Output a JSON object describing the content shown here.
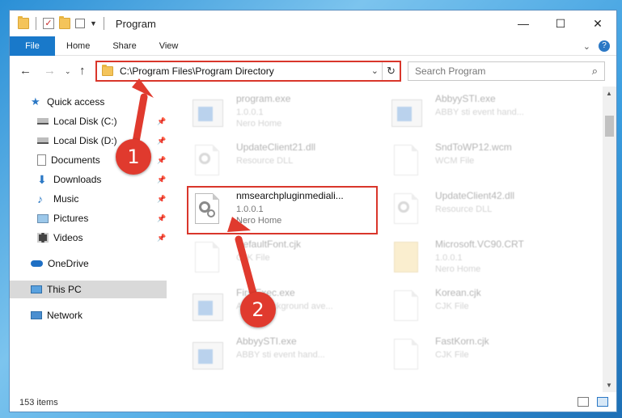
{
  "window": {
    "title": "Program"
  },
  "ribbon": {
    "tabs": [
      "File",
      "Home",
      "Share",
      "View"
    ]
  },
  "address": {
    "path": "C:\\Program Files\\Program Directory"
  },
  "search": {
    "placeholder": "Search Program"
  },
  "sidebar": {
    "items": [
      {
        "label": "Quick access",
        "icon": "star-icon"
      },
      {
        "label": "Local Disk (C:)",
        "icon": "drive-icon"
      },
      {
        "label": "Local Disk (D:)",
        "icon": "drive-icon"
      },
      {
        "label": "Documents",
        "icon": "documents-icon"
      },
      {
        "label": "Downloads",
        "icon": "download-icon"
      },
      {
        "label": "Music",
        "icon": "music-icon"
      },
      {
        "label": "Pictures",
        "icon": "pictures-icon"
      },
      {
        "label": "Videos",
        "icon": "videos-icon"
      },
      {
        "label": "OneDrive",
        "icon": "cloud-icon"
      },
      {
        "label": "This PC",
        "icon": "computer-icon"
      },
      {
        "label": "Network",
        "icon": "network-icon"
      }
    ]
  },
  "files": [
    {
      "name": "program.exe",
      "l2": "1.0.0.1",
      "l3": "Nero Home"
    },
    {
      "name": "AbbyySTI.exe",
      "l2": "ABBY sti event hand...",
      "l3": ""
    },
    {
      "name": "UpdateClient21.dll",
      "l2": "Resource DLL",
      "l3": ""
    },
    {
      "name": "SndToWP12.wcm",
      "l2": "WCM File",
      "l3": ""
    },
    {
      "name": "nmsearchpluginmediali...",
      "l2": "1.0.0.1",
      "l3": "Nero Home"
    },
    {
      "name": "UpdateClient42.dll",
      "l2": "Resource DLL",
      "l3": ""
    },
    {
      "name": "DefaultFont.cjk",
      "l2": "CJK File",
      "l3": ""
    },
    {
      "name": "Microsoft.VC90.CRT",
      "l2": "1.0.0.1",
      "l3": "Nero Home"
    },
    {
      "name": "FirstExec.exe",
      "l2": "ABBY background ave...",
      "l3": ""
    },
    {
      "name": "Korean.cjk",
      "l2": "CJK File",
      "l3": ""
    },
    {
      "name": "AbbyySTI.exe",
      "l2": "ABBY sti event hand...",
      "l3": ""
    },
    {
      "name": "FastKorn.cjk",
      "l2": "CJK File",
      "l3": ""
    }
  ],
  "status": {
    "count": "153 items"
  },
  "markers": {
    "one": "1",
    "two": "2"
  },
  "colors": {
    "accent": "#1979ca",
    "highlight": "#d9362b"
  }
}
